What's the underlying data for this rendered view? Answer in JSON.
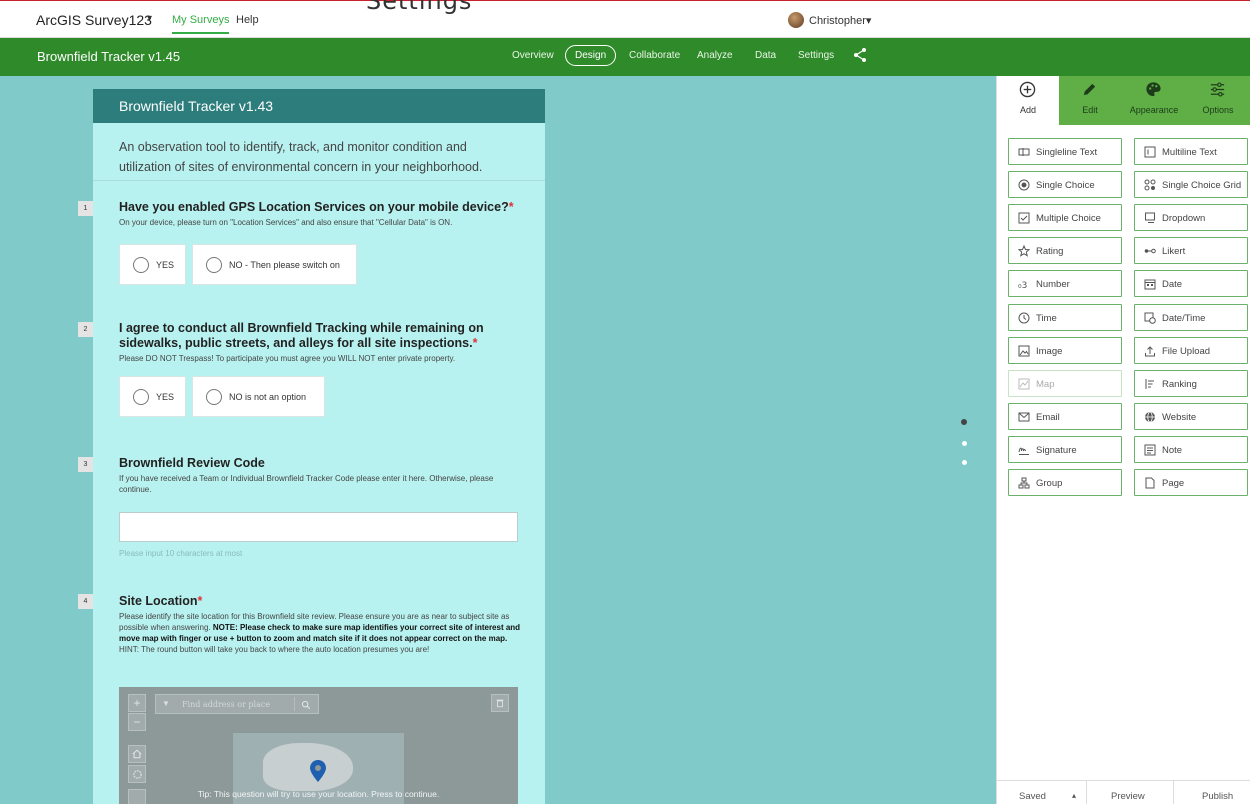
{
  "top_bar": {
    "clipped_heading": "Settings",
    "brand": "ArcGIS Survey123",
    "brand_caret": "▾",
    "nav": {
      "my_surveys": "My Surveys",
      "help": "Help"
    },
    "user": "Christopher▾"
  },
  "survey_bar": {
    "title": "Brownfield Tracker v1.45",
    "tabs": [
      "Overview",
      "Design",
      "Collaborate",
      "Analyze",
      "Data",
      "Settings"
    ],
    "active_tab": "Design"
  },
  "form": {
    "header": "Brownfield Tracker v1.43",
    "description": "An observation tool to identify, track, and monitor condition and utilization of sites of environmental concern in your neighborhood.",
    "questions": [
      {
        "number": "1",
        "title": "Have you enabled GPS Location Services on your mobile device?",
        "required": "*",
        "hint": "On your device, please turn on \"Location Services\" and also ensure that \"Cellular Data\" is ON.",
        "options": [
          "YES",
          "NO - Then please switch on"
        ]
      },
      {
        "number": "2",
        "title": "I agree to conduct all Brownfield Tracking while remaining on sidewalks, public streets, and alleys for all site inspections.",
        "required": "*",
        "hint": "Please DO NOT Trespass! To participate you must agree you WILL NOT enter private property.",
        "options": [
          "YES",
          "NO is not an option"
        ]
      },
      {
        "number": "3",
        "title": "Brownfield Review Code",
        "hint": "If you have received a Team or Individual Brownfield Tracker Code please enter it here. Otherwise, please continue.",
        "input_value": "",
        "input_hint": "Please input 10 characters at most"
      },
      {
        "number": "4",
        "title": "Site Location",
        "required": "*",
        "hint_parts": {
          "intro": "Please identify the site location for this Brownfield site review. Please ensure you are as near to subject site as possible when answering. ",
          "bold": "NOTE: Please check to make sure map identifies your correct site of interest and move map with finger or use + button to zoom and match site if it does not appear correct on the map.",
          "outro": " HINT: The round button will take you back to where the auto location presumes you are!"
        }
      }
    ],
    "map": {
      "search_placeholder": "Find address or place",
      "zoom_in": "+",
      "zoom_out": "−",
      "tip": "Tip: This question will try to use your location. Press to continue."
    }
  },
  "panel": {
    "tabs": [
      {
        "label": "Add",
        "icon": "add-circle-icon"
      },
      {
        "label": "Edit",
        "icon": "pencil-icon"
      },
      {
        "label": "Appearance",
        "icon": "palette-icon"
      },
      {
        "label": "Options",
        "icon": "sliders-icon"
      }
    ],
    "active_tab": "Add",
    "question_types": [
      {
        "label": "Singleline Text",
        "icon": "singleline-text-icon"
      },
      {
        "label": "Multiline Text",
        "icon": "multiline-text-icon"
      },
      {
        "label": "Single Choice",
        "icon": "radio-icon"
      },
      {
        "label": "Single Choice Grid",
        "icon": "grid-icon"
      },
      {
        "label": "Multiple Choice",
        "icon": "checkbox-icon"
      },
      {
        "label": "Dropdown",
        "icon": "dropdown-icon"
      },
      {
        "label": "Rating",
        "icon": "star-icon"
      },
      {
        "label": "Likert",
        "icon": "likert-icon"
      },
      {
        "label": "Number",
        "icon": "number-icon"
      },
      {
        "label": "Date",
        "icon": "calendar-icon"
      },
      {
        "label": "Time",
        "icon": "clock-icon"
      },
      {
        "label": "Date/Time",
        "icon": "datetime-icon"
      },
      {
        "label": "Image",
        "icon": "image-icon"
      },
      {
        "label": "File Upload",
        "icon": "upload-icon"
      },
      {
        "label": "Map",
        "icon": "map-icon",
        "disabled": true
      },
      {
        "label": "Ranking",
        "icon": "ranking-icon"
      },
      {
        "label": "Email",
        "icon": "email-icon"
      },
      {
        "label": "Website",
        "icon": "globe-icon"
      },
      {
        "label": "Signature",
        "icon": "signature-icon"
      },
      {
        "label": "Note",
        "icon": "note-icon"
      },
      {
        "label": "Group",
        "icon": "group-icon"
      },
      {
        "label": "Page",
        "icon": "page-icon"
      }
    ],
    "footer": {
      "saved": "Saved",
      "saved_caret": "▴",
      "preview": "Preview",
      "publish": "Publish"
    }
  },
  "colors": {
    "brand_green": "#2f8a2a",
    "panel_tab_green": "#5fae46",
    "canvas_teal": "#80caca",
    "form_bg": "#b8f2f0",
    "form_header": "#2d7d7d",
    "required_red": "#e0303a"
  }
}
